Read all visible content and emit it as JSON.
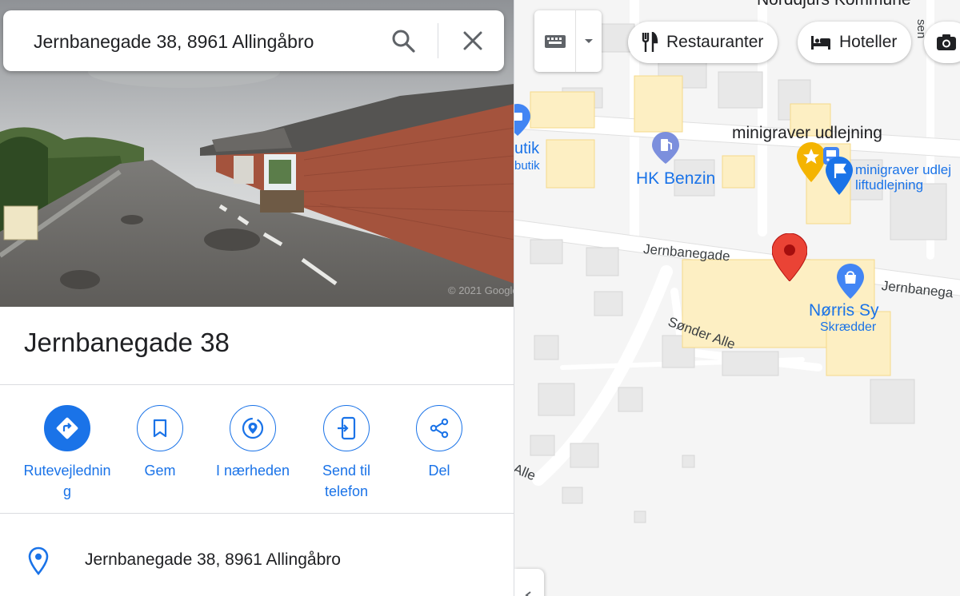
{
  "search": {
    "value": "Jernbanegade 38, 8961 Allingåbro",
    "search_icon": "search-icon",
    "close_icon": "close-icon"
  },
  "place": {
    "title": "Jernbanegade 38",
    "photo_watermark": "© 2021 Google"
  },
  "actions": [
    {
      "label": "Rutevejledning",
      "icon": "directions-icon"
    },
    {
      "label": "Gem",
      "icon": "bookmark-icon"
    },
    {
      "label": "I nærheden",
      "icon": "nearby-icon"
    },
    {
      "label": "Send til telefon",
      "icon": "send-to-phone-icon"
    },
    {
      "label": "Del",
      "icon": "share-icon"
    }
  ],
  "address": {
    "text": "Jernbanegade 38, 8961 Allingåbro",
    "icon": "location-pin-icon"
  },
  "map": {
    "chips": [
      {
        "label": "Restauranter",
        "icon": "fork-knife-icon"
      },
      {
        "label": "Hoteller",
        "icon": "bed-icon"
      }
    ],
    "labels": {
      "municipality": "Norddjurs Kommune",
      "road_vertical": "sen",
      "butik_1": "utik",
      "butik_2": "butik",
      "hk_benzin": "HK Benzin",
      "minigraver_top": "minigraver udlejning",
      "minigraver_poi_1": "minigraver udlej",
      "minigraver_poi_2": "liftudlejning",
      "jernbanegade_1": "Jernbanegade",
      "jernbanegade_2": "Jernbanega",
      "norris_sy": "Nørris Sy",
      "skraedder": "Skrædder",
      "sonder_alle": "Sønder Alle",
      "alle": "Alle"
    },
    "colors": {
      "accent": "#1a73e8",
      "pin_red": "#ea4335",
      "star_gold": "#f4b400",
      "building": "#e8e8e8",
      "highlight_building": "#fdefc3"
    }
  }
}
